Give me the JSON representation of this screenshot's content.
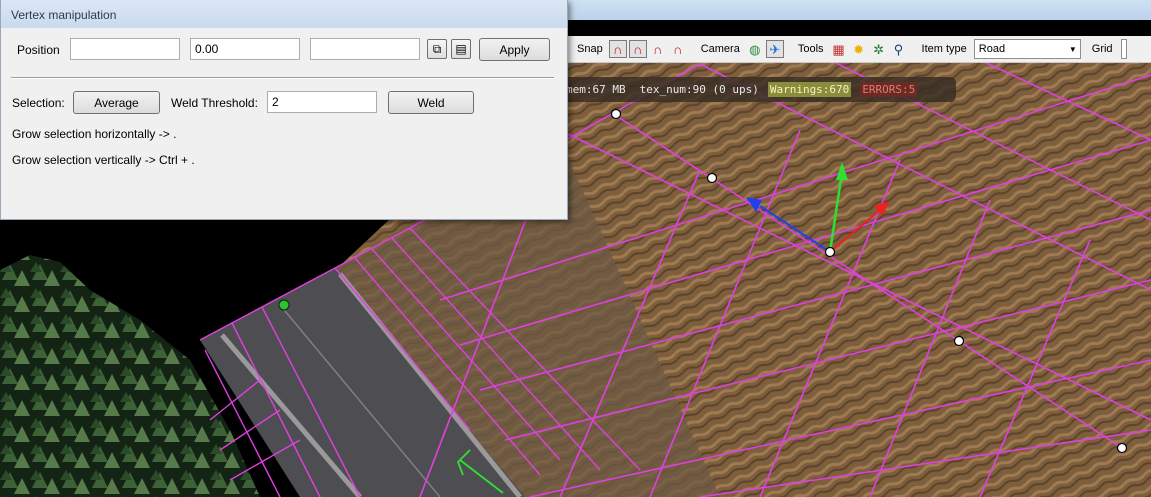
{
  "dialog": {
    "title": "Vertex manipulation",
    "position_label": "Position",
    "position_x": "",
    "position_y": "0.00",
    "position_z": "",
    "copy_icon": "copy-icon",
    "paste_icon": "paste-icon",
    "apply_label": "Apply",
    "selection_label": "Selection:",
    "average_label": "Average",
    "weld_threshold_label": "Weld Threshold:",
    "weld_threshold_value": "2",
    "weld_label": "Weld",
    "hint_horizontal": "Grow selection horizontally -> .",
    "hint_vertical": "Grow selection vertically -> Ctrl + ."
  },
  "toolbar": {
    "snap_label": "Snap",
    "camera_label": "Camera",
    "tools_label": "Tools",
    "item_type_label": "Item type",
    "item_type_value": "Road",
    "grid_label": "Grid",
    "snap_icons": [
      "magnet-icon",
      "magnet-vertex-icon",
      "magnet-edge-icon",
      "magnet-off-icon"
    ],
    "camera_icons": [
      "globe-icon",
      "bird-icon"
    ],
    "tools_icons": [
      "color-grid-icon",
      "sun-icon",
      "gear-icon",
      "search-icon"
    ],
    "colors": {
      "magnet": "#cc1111",
      "globe": "#2a8a3a",
      "bird": "#1f6fd0",
      "sun": "#f0b000",
      "gear": "#1f7a2f"
    }
  },
  "status": {
    "mem": "mem:67 MB",
    "tex": "tex_num:90 (0 ups)",
    "warnings": "Warnings:670",
    "errors": "ERRORS:5"
  },
  "viewport": {
    "grid_color": "#e040e0",
    "terrain_color": "#7a5a3a",
    "road_color": "#55555a",
    "gizmo_colors": {
      "x": "#ee2020",
      "y": "#30e030",
      "z": "#2040ee"
    }
  }
}
